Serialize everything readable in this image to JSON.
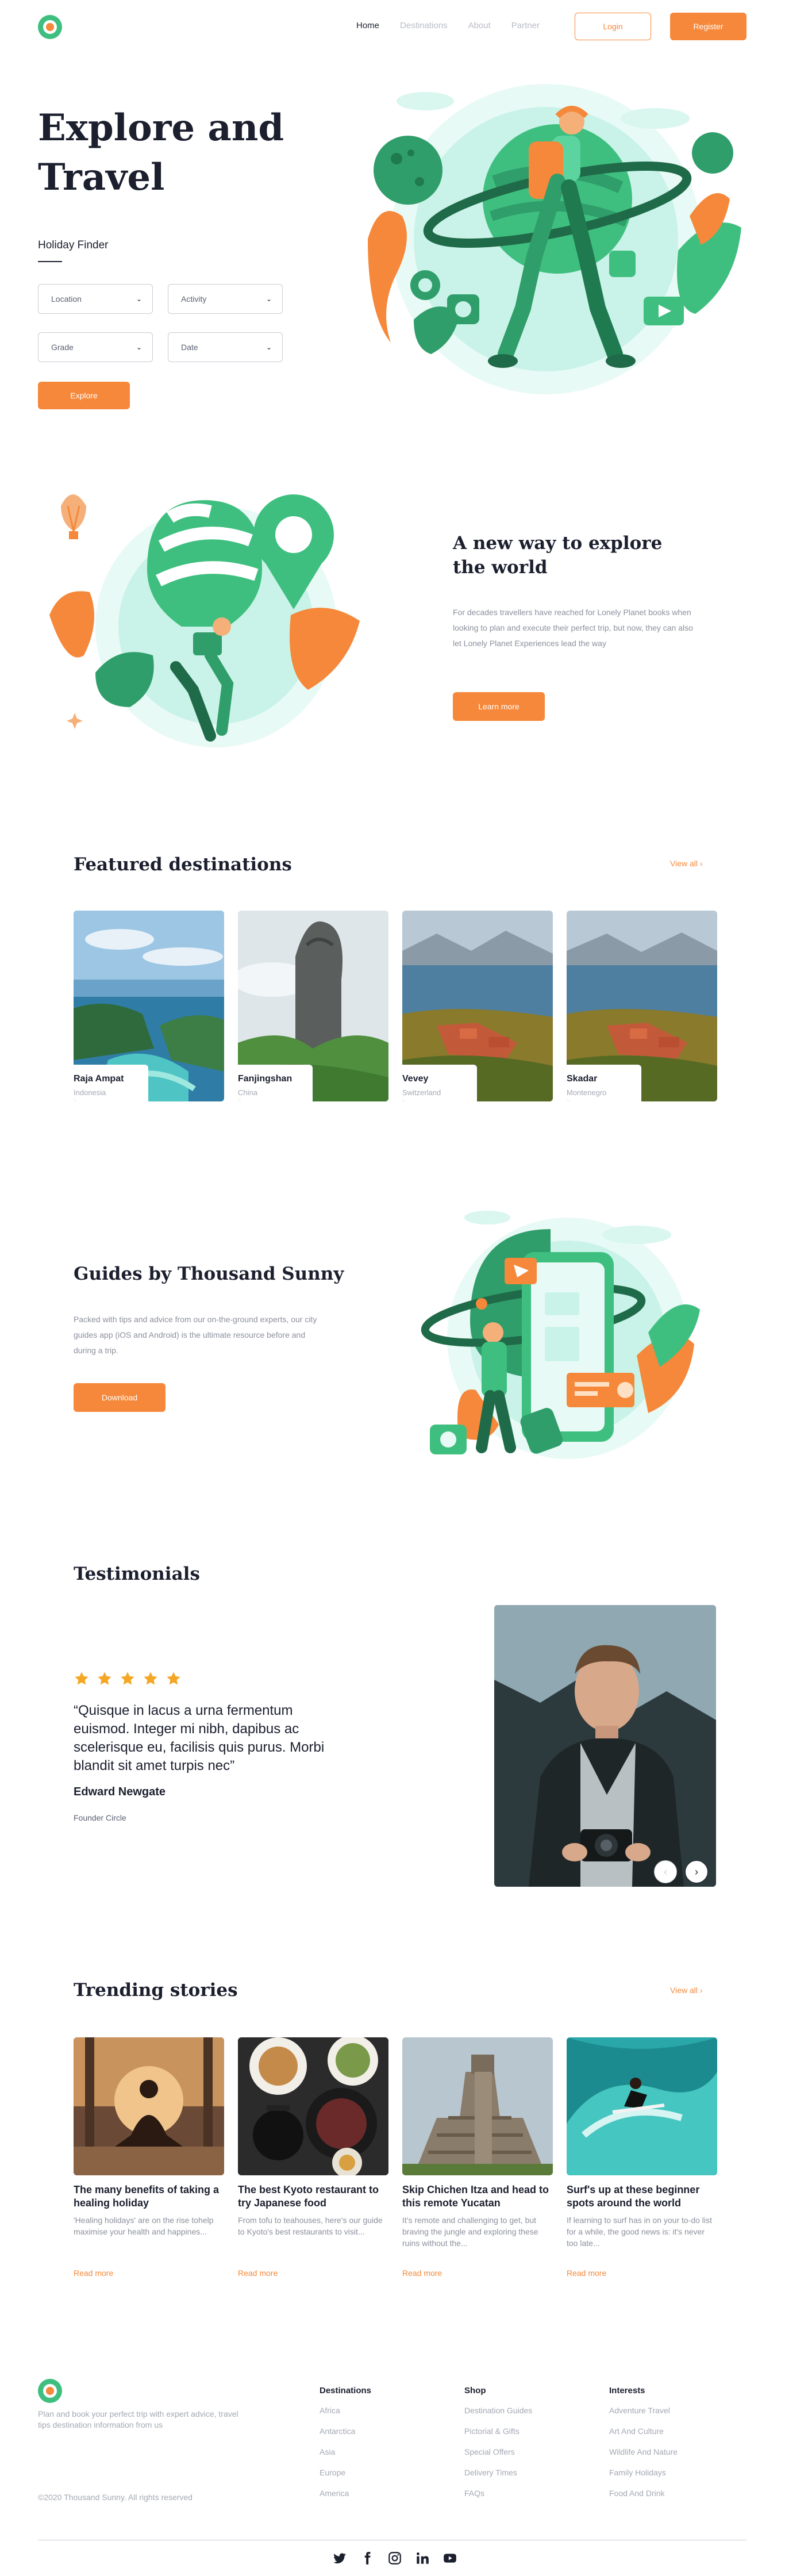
{
  "nav": {
    "links": [
      {
        "label": "Home",
        "active": true
      },
      {
        "label": "Destinations",
        "active": false
      },
      {
        "label": "About",
        "active": false
      },
      {
        "label": "Partner",
        "active": false
      }
    ],
    "login_label": "Login",
    "register_label": "Register"
  },
  "hero": {
    "title_line1": "Explore and",
    "title_line2": "Travel",
    "finder_label": "Holiday Finder",
    "selects": [
      "Location",
      "Activity",
      "Grade",
      "Date"
    ],
    "explore_label": "Explore"
  },
  "about": {
    "title": "A new way to explore the world",
    "body": "For decades travellers have reached for Lonely Planet books when looking to plan and execute their perfect trip, but now, they can also let Lonely Planet Experiences lead the way",
    "cta": "Learn more"
  },
  "featured": {
    "title": "Featured destinations",
    "view_all": "View all",
    "items": [
      {
        "name": "Raja Ampat",
        "country": "Indonesia"
      },
      {
        "name": "Fanjingshan",
        "country": "China"
      },
      {
        "name": "Vevey",
        "country": "Switzerland"
      },
      {
        "name": "Skadar",
        "country": "Montenegro"
      }
    ]
  },
  "guides": {
    "title": "Guides by Thousand Sunny",
    "body": "Packed with tips and advice from our on-the-ground experts, our city guides app (iOS and Android) is the ultimate resource before and during a trip.",
    "cta": "Download"
  },
  "testimonials": {
    "title": "Testimonials",
    "rating": 5,
    "quote": "“Quisque in lacus a urna fermentum euismod. Integer mi nibh, dapibus ac scelerisque eu, facilisis quis purus. Morbi blandit sit amet turpis nec”",
    "author": "Edward Newgate",
    "role": "Founder Circle"
  },
  "stories": {
    "title": "Trending stories",
    "view_all": "View all",
    "read_more": "Read more",
    "items": [
      {
        "title": "The many benefits of taking a healing holiday",
        "excerpt": "'Healing holidays' are on the rise tohelp maximise your health and happines..."
      },
      {
        "title": "The best Kyoto restaurant to try Japanese food",
        "excerpt": "From tofu to teahouses, here's our guide to Kyoto's best restaurants to visit..."
      },
      {
        "title": "Skip Chichen Itza and head to this remote Yucatan",
        "excerpt": "It's remote and challenging to get, but braving the jungle and exploring these ruins without the..."
      },
      {
        "title": "Surf's up at these beginner spots around the world",
        "excerpt": "If learning to surf has in on your to-do list for a while, the good news is: it's never too late..."
      }
    ]
  },
  "footer": {
    "description": "Plan and book your perfect trip with expert advice, travel tips destination information from us",
    "copyright": "©2020 Thousand Sunny. All rights reserved",
    "columns": [
      {
        "title": "Destinations",
        "items": [
          "Africa",
          "Antarctica",
          "Asia",
          "Europe",
          "America"
        ]
      },
      {
        "title": "Shop",
        "items": [
          "Destination Guides",
          "Pictorial & Gifts",
          "Special Offers",
          "Delivery Times",
          "FAQs"
        ]
      },
      {
        "title": "Interests",
        "items": [
          "Adventure Travel",
          "Art And Culture",
          "Wildlife And Nature",
          "Family Holidays",
          "Food And Drink"
        ]
      }
    ],
    "socials": [
      "twitter-icon",
      "facebook-icon",
      "instagram-icon",
      "linkedin-icon",
      "youtube-icon"
    ]
  },
  "colors": {
    "accent": "#f5883a",
    "brand_green": "#3fbf7f",
    "text_dark": "#1b1f2e",
    "text_muted": "#8b909c"
  }
}
